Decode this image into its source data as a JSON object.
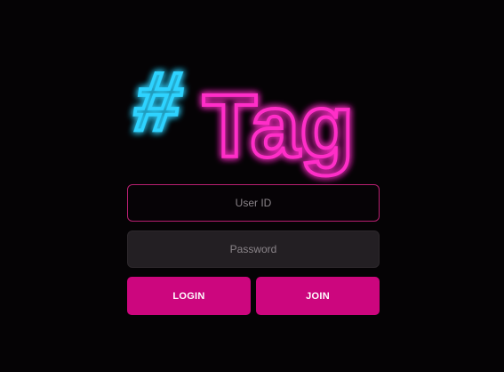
{
  "logo": {
    "hash": "#",
    "word": "Tag",
    "hash_color": "#2fd3ff",
    "word_color": "#ff2fc8"
  },
  "login": {
    "userid_placeholder": "User ID",
    "password_placeholder": "Password",
    "login_label": "LOGIN",
    "join_label": "JOIN"
  },
  "colors": {
    "background": "#050305",
    "accent": "#cc067e",
    "input_border": "#b81f71"
  }
}
